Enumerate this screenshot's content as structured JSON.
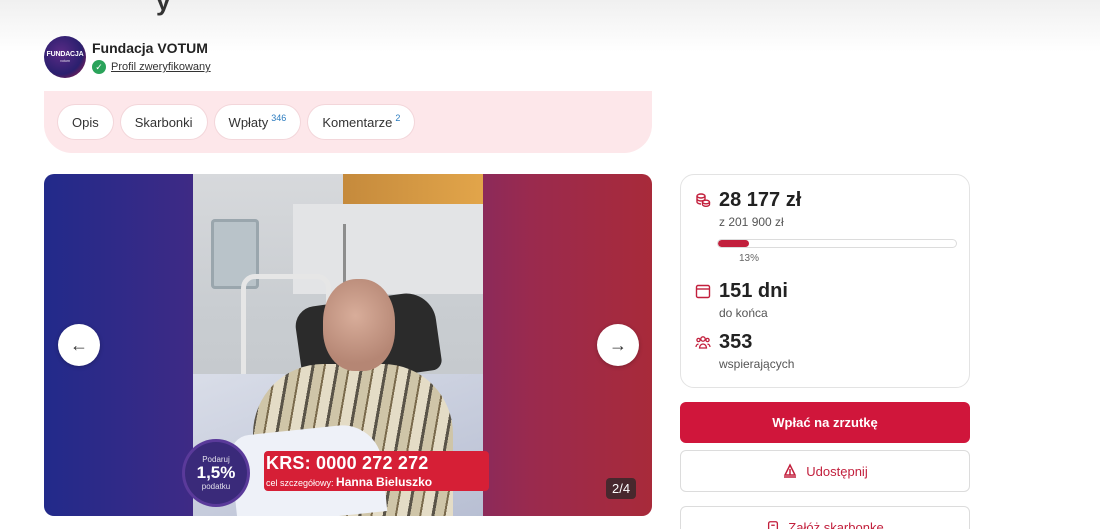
{
  "page": {
    "title_fragment": "y"
  },
  "org": {
    "name": "Fundacja VOTUM",
    "logo_text": "FUNDACJA",
    "logo_subtext": "votum",
    "verified_label": "Profil zweryfikowany"
  },
  "tabs": [
    {
      "label": "Opis",
      "count": ""
    },
    {
      "label": "Skarbonki",
      "count": ""
    },
    {
      "label": "Wpłaty",
      "count": "346"
    },
    {
      "label": "Komentarze",
      "count": "2"
    }
  ],
  "gallery": {
    "counter": "2/4",
    "promo": {
      "krs": "KRS: 0000 272 272",
      "target_prefix": "cel szczegółowy:",
      "target_name": "Hanna Bieluszko",
      "circle_top": "Podaruj",
      "circle_main": "1,5%",
      "circle_bottom": "podatku"
    }
  },
  "stats": {
    "raised": "28 177 zł",
    "goal": "z 201 900 zł",
    "progress_percent": 13,
    "progress_label": "13%",
    "days": "151 dni",
    "days_label": "do końca",
    "supporters": "353",
    "supporters_label": "wspierających"
  },
  "actions": {
    "donate": "Wpłać na zrzutkę",
    "share": "Udostępnij",
    "piggy": "Załóż skarbonkę"
  },
  "colors": {
    "accent": "#d0163b",
    "tabs_bg": "#fde7ea",
    "verified": "#2aa35a"
  }
}
